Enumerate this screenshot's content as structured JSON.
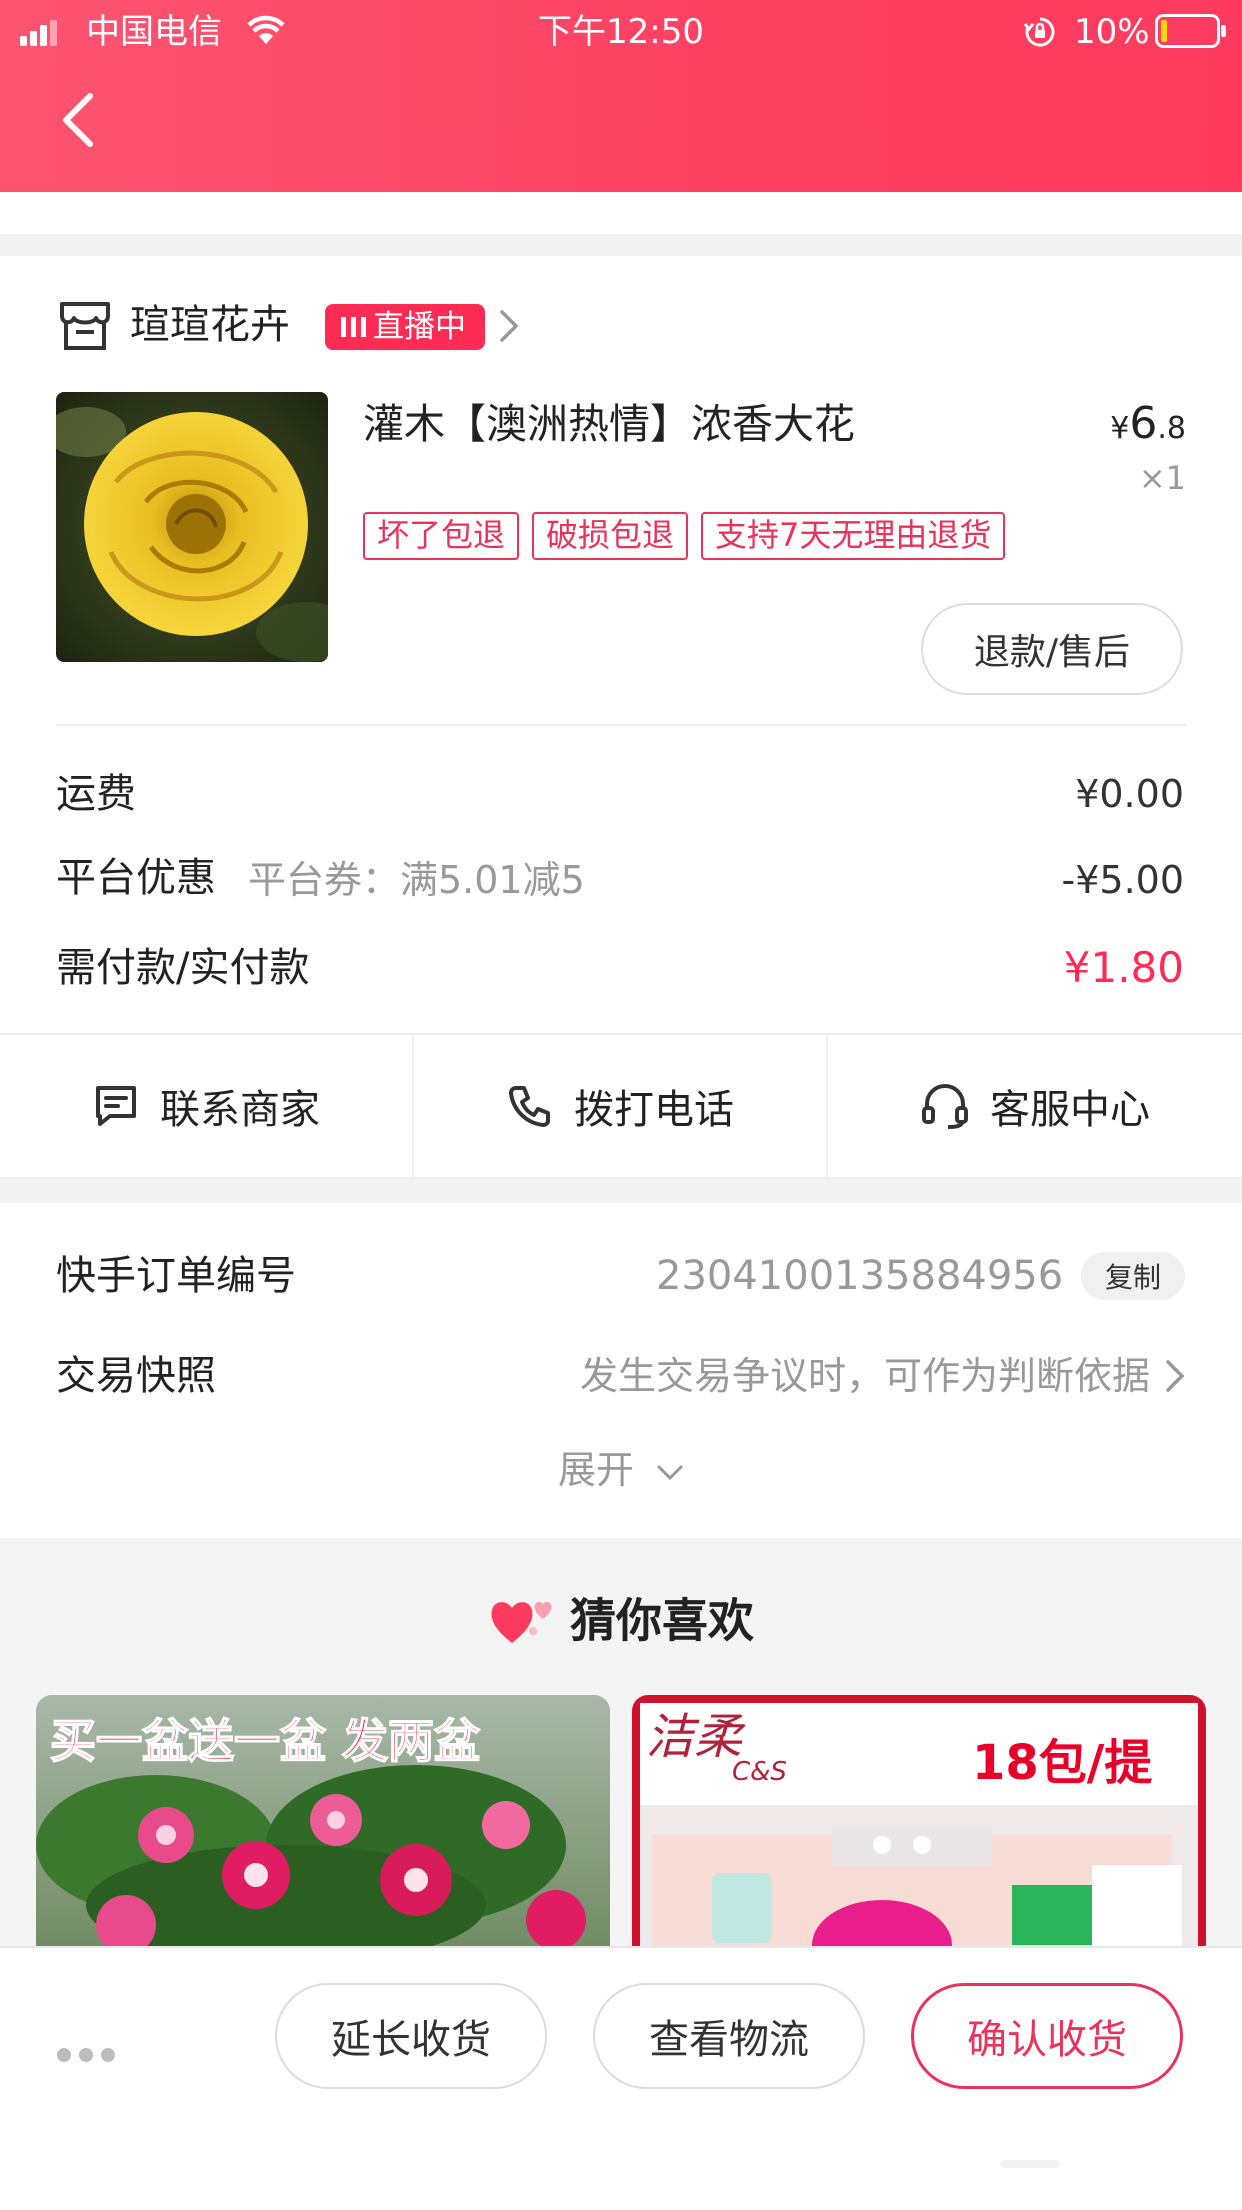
{
  "status_bar": {
    "carrier": "中国电信",
    "time": "下午12:50",
    "battery": "10%"
  },
  "shop": {
    "name": "瑄瑄花卉",
    "live_badge": "直播中"
  },
  "product": {
    "title": "灌木【澳洲热情】浓香大花",
    "price_symbol": "¥",
    "price_int": "6",
    "price_dec": ".8",
    "quantity": "×1",
    "tags": [
      "坏了包退",
      "破损包退",
      "支持7天无理由退货"
    ],
    "refund_button": "退款/售后"
  },
  "fees": {
    "shipping_label": "运费",
    "shipping_value": "¥0.00",
    "discount_label": "平台优惠",
    "discount_sub": "平台券：满5.01减5",
    "discount_value": "-¥5.00",
    "pay_label": "需付款/实付款",
    "pay_value": "¥1.80"
  },
  "actions": {
    "contact_merchant": "联系商家",
    "call_phone": "拨打电话",
    "service_center": "客服中心"
  },
  "order": {
    "number_label": "快手订单编号",
    "number_value": "2304100135884956",
    "copy_button": "复制",
    "snapshot_label": "交易快照",
    "snapshot_value": "发生交易争议时，可作为判断依据",
    "expand": "展开"
  },
  "recommend": {
    "title": "猜你喜欢",
    "card1_text": "买一盆送一盆 发两盆",
    "card2_brand": "洁柔",
    "card2_brand_sub": "C&S",
    "card2_text": "18包/提"
  },
  "bottom_bar": {
    "extend_button": "延长收货",
    "logistics_button": "查看物流",
    "confirm_button": "确认收货"
  },
  "colors": {
    "brand": "#fe2c55",
    "header": "#fd4062",
    "tag": "#e8335a"
  }
}
